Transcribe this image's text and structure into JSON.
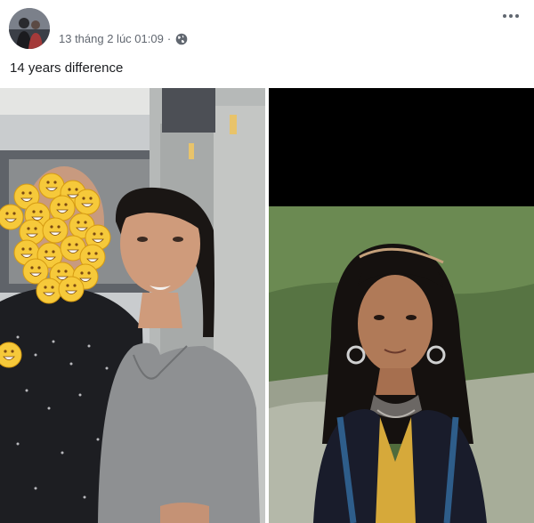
{
  "post": {
    "timestamp": "13 tháng 2 lúc 01:09",
    "separator": "·",
    "privacy_icon": "globe-icon",
    "text": "14 years difference",
    "menu_icon": "more-options-icon"
  },
  "photos": [
    {
      "name": "photo-left",
      "content": "woman-with-blurred-face-person"
    },
    {
      "name": "photo-right",
      "content": "young-girl-outdoors"
    }
  ],
  "colors": {
    "meta_text": "#616770",
    "post_text": "#1c1e21",
    "divider": "#ffffff"
  }
}
